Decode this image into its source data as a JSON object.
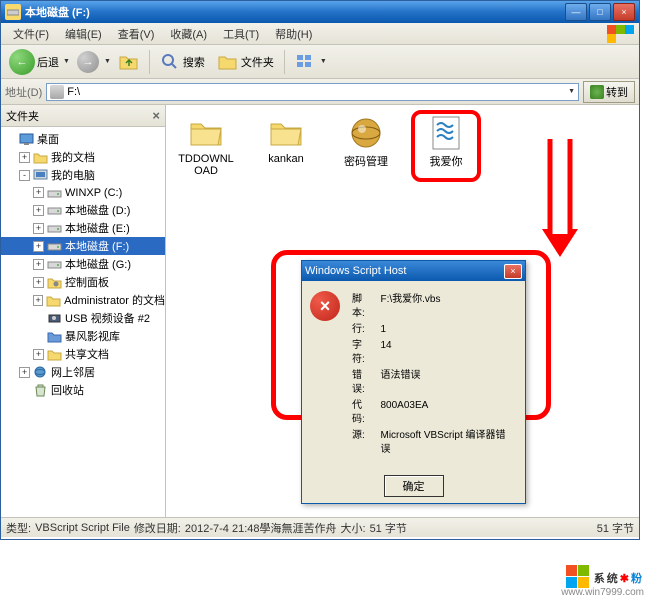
{
  "titlebar": {
    "title": "本地磁盘 (F:)"
  },
  "menu": {
    "file": "文件(F)",
    "edit": "编辑(E)",
    "view": "查看(V)",
    "favorites": "收藏(A)",
    "tools": "工具(T)",
    "help": "帮助(H)"
  },
  "toolbar": {
    "back": "后退",
    "search": "搜索",
    "folders": "文件夹"
  },
  "addressbar": {
    "label": "地址(D)",
    "path": "F:\\",
    "go": "转到"
  },
  "sidebar": {
    "title": "文件夹",
    "items": [
      {
        "label": "桌面",
        "icon": "desktop",
        "indent": 0,
        "expand": null
      },
      {
        "label": "我的文档",
        "icon": "folder",
        "indent": 1,
        "expand": "+"
      },
      {
        "label": "我的电脑",
        "icon": "computer",
        "indent": 1,
        "expand": "-"
      },
      {
        "label": "WINXP (C:)",
        "icon": "drive",
        "indent": 2,
        "expand": "+"
      },
      {
        "label": "本地磁盘 (D:)",
        "icon": "drive",
        "indent": 2,
        "expand": "+"
      },
      {
        "label": "本地磁盘 (E:)",
        "icon": "drive",
        "indent": 2,
        "expand": "+"
      },
      {
        "label": "本地磁盘 (F:)",
        "icon": "drive",
        "indent": 2,
        "expand": "+",
        "selected": true
      },
      {
        "label": "本地磁盘 (G:)",
        "icon": "drive",
        "indent": 2,
        "expand": "+"
      },
      {
        "label": "控制面板",
        "icon": "control",
        "indent": 2,
        "expand": "+"
      },
      {
        "label": "Administrator 的文档",
        "icon": "folder",
        "indent": 2,
        "expand": "+"
      },
      {
        "label": "USB 视频设备 #2",
        "icon": "camera",
        "indent": 2,
        "expand": null
      },
      {
        "label": "暴风影视库",
        "icon": "folder-blue",
        "indent": 2,
        "expand": null
      },
      {
        "label": "共享文档",
        "icon": "folder",
        "indent": 2,
        "expand": "+"
      },
      {
        "label": "网上邻居",
        "icon": "network",
        "indent": 1,
        "expand": "+"
      },
      {
        "label": "回收站",
        "icon": "recycle",
        "indent": 1,
        "expand": null
      }
    ]
  },
  "files": [
    {
      "name": "TDDOWNLOAD",
      "type": "folder"
    },
    {
      "name": "kankan",
      "type": "folder"
    },
    {
      "name": "密码管理",
      "type": "app"
    },
    {
      "name": "我爱你",
      "type": "vbs",
      "highlighted": true
    }
  ],
  "dialog": {
    "title": "Windows Script Host",
    "rows": [
      {
        "k": "脚本:",
        "v": "F:\\我爱你.vbs"
      },
      {
        "k": "行:",
        "v": "1"
      },
      {
        "k": "字符:",
        "v": "14"
      },
      {
        "k": "错误:",
        "v": "语法错误"
      },
      {
        "k": "代码:",
        "v": "800A03EA"
      },
      {
        "k": "源:",
        "v": "Microsoft VBScript 编译器错误"
      }
    ],
    "ok": "确定"
  },
  "statusbar": {
    "type_label": "类型:",
    "type_value": "VBScript Script File",
    "modified_label": "修改日期:",
    "modified_value": "2012-7-4 21:48學海無涯苦作舟",
    "size_label": "大小:",
    "size_value": "51 字节",
    "size_right": "51 字节"
  },
  "watermark": {
    "brand1": "系统",
    "brand2": "粉",
    "url": "www.win7999.com"
  },
  "icons": {
    "x": "×",
    "min": "—",
    "max": "□",
    "left": "←",
    "right": "→",
    "down": "▼"
  }
}
